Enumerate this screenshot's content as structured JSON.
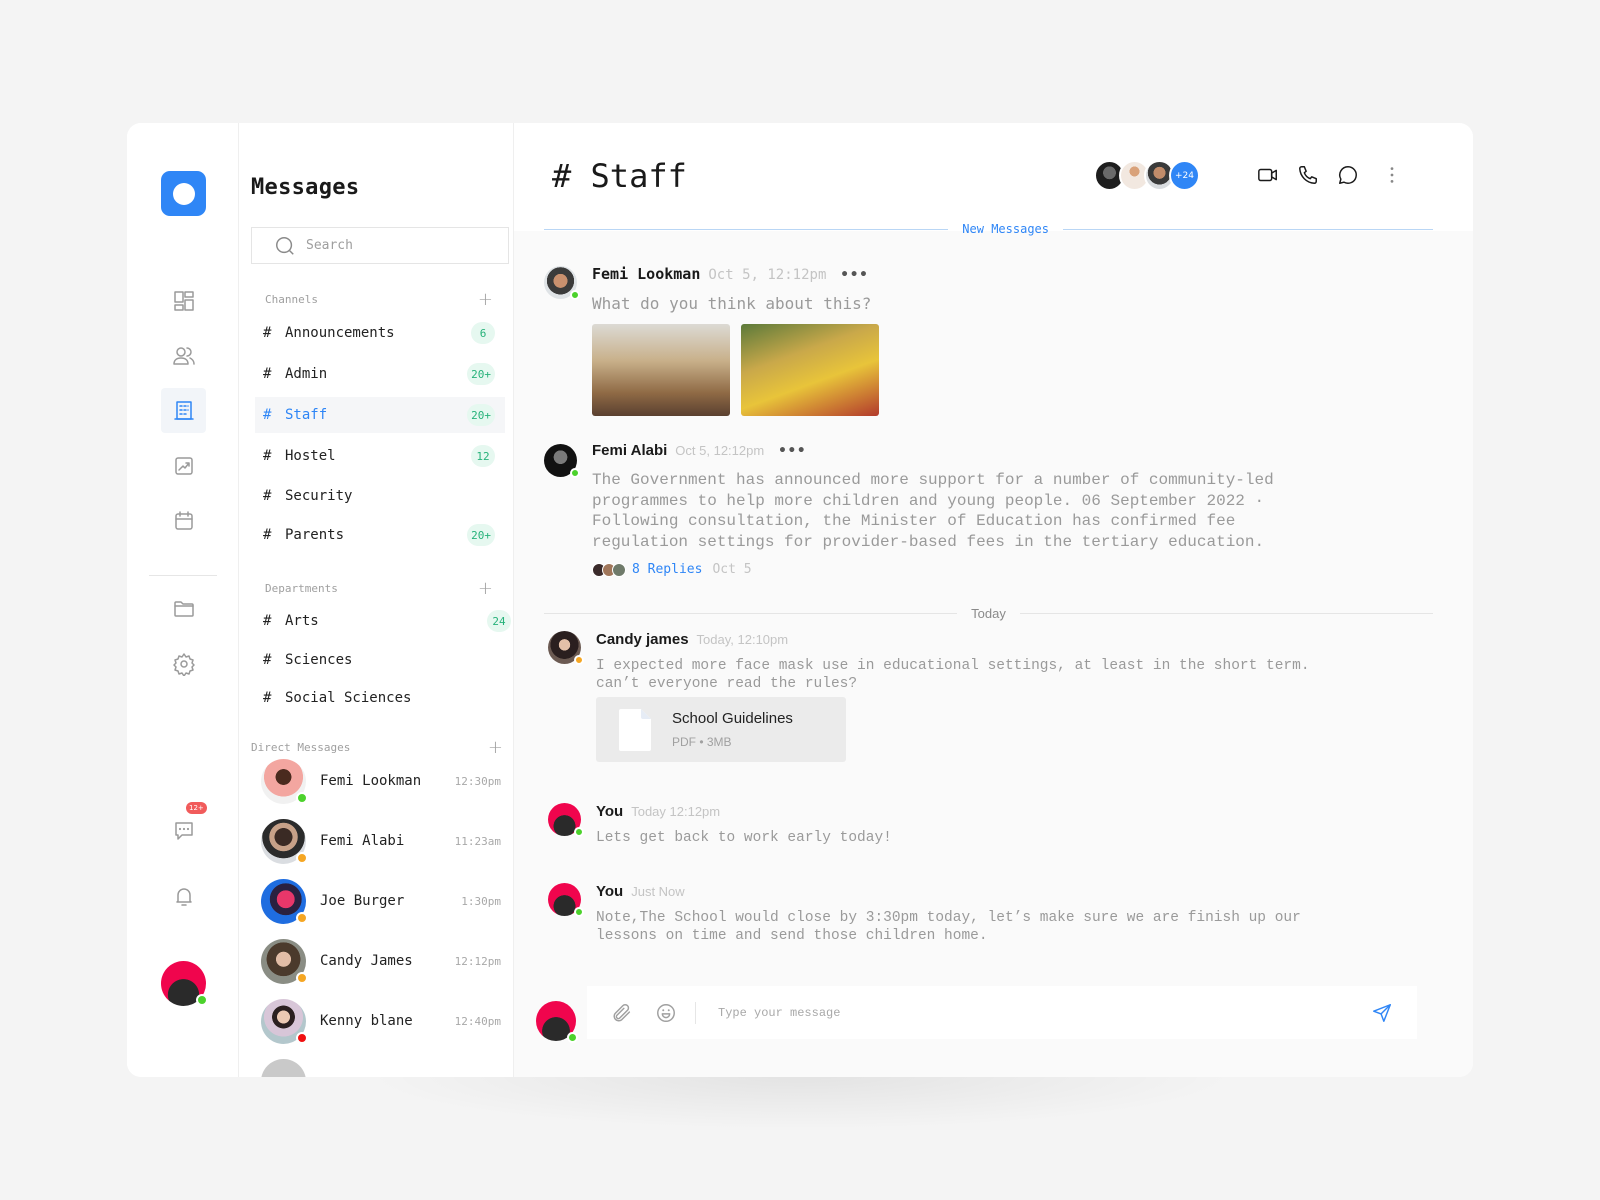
{
  "rail": {
    "nav_items": [
      {
        "icon": "dashboard-icon",
        "active": false
      },
      {
        "icon": "users-icon",
        "active": false
      },
      {
        "icon": "building-icon",
        "active": true
      },
      {
        "icon": "chart-icon",
        "active": false
      },
      {
        "icon": "calendar-icon",
        "active": false
      },
      {
        "icon": "folder-icon",
        "active": false
      },
      {
        "icon": "settings-icon",
        "active": false
      }
    ],
    "chat_badge": "12+",
    "brand_color": "#2f86f6"
  },
  "panel": {
    "title": "Messages",
    "search_placeholder": "Search",
    "channels_label": "Channels",
    "channels": [
      {
        "name": "Announcements",
        "badge": "6"
      },
      {
        "name": "Admin",
        "badge": "20+"
      },
      {
        "name": "Staff",
        "badge": "20+",
        "active": true
      },
      {
        "name": "Hostel",
        "badge": "12"
      },
      {
        "name": "Security",
        "badge": ""
      },
      {
        "name": "Parents",
        "badge": "20+"
      }
    ],
    "departments_label": "Departments",
    "departments": [
      {
        "name": "Arts",
        "badge": "24"
      },
      {
        "name": "Sciences",
        "badge": ""
      },
      {
        "name": "Social Sciences",
        "badge": ""
      }
    ],
    "dm_label": "Direct Messages",
    "direct_messages": [
      {
        "name": "Femi Lookman",
        "time": "12:30pm",
        "status": "online"
      },
      {
        "name": "Femi Alabi",
        "time": "11:23am",
        "status": "away"
      },
      {
        "name": "Joe Burger",
        "time": "1:30pm",
        "status": "away"
      },
      {
        "name": "Candy James",
        "time": "12:12pm",
        "status": "away"
      },
      {
        "name": "Kenny blane",
        "time": "12:40pm",
        "status": "busy"
      }
    ]
  },
  "main": {
    "hash": "#",
    "channel_title": "Staff",
    "members_more": "+24",
    "new_messages_label": "New Messages",
    "today_label": "Today",
    "messages": [
      {
        "author": "Femi Lookman",
        "time": "Oct 5, 12:12pm",
        "body": "What do you think about this?",
        "status": "online",
        "attachments": "2 images"
      },
      {
        "author": "Femi Alabi",
        "time": "Oct 5, 12:12pm",
        "body": "The Government has announced more support for a number of community-led\nprogrammes to help more children and young people. 06 September 2022 ·\nFollowing consultation, the Minister of Education has confirmed fee\nregulation settings for provider-based fees in the tertiary education.",
        "status": "online",
        "replies": "8 Replies",
        "replies_time": "Oct 5"
      },
      {
        "author": "Candy james",
        "time": "Today, 12:10pm",
        "body": "I expected more face mask use in educational settings, at least in the short term.\ncan’t everyone read the rules?",
        "status": "away",
        "file": {
          "name": "School Guidelines",
          "meta": "PDF • 3MB"
        }
      },
      {
        "author": "You",
        "time": "Today 12:12pm",
        "body": "Lets get back to work early today!",
        "status": "online"
      },
      {
        "author": "You",
        "time": "Just Now",
        "body": "Note,The School would close by 3:30pm today, let’s make sure we are finish up our\nlessons on time and send those children home.",
        "status": "online"
      }
    ],
    "composer_placeholder": "Type your message"
  }
}
